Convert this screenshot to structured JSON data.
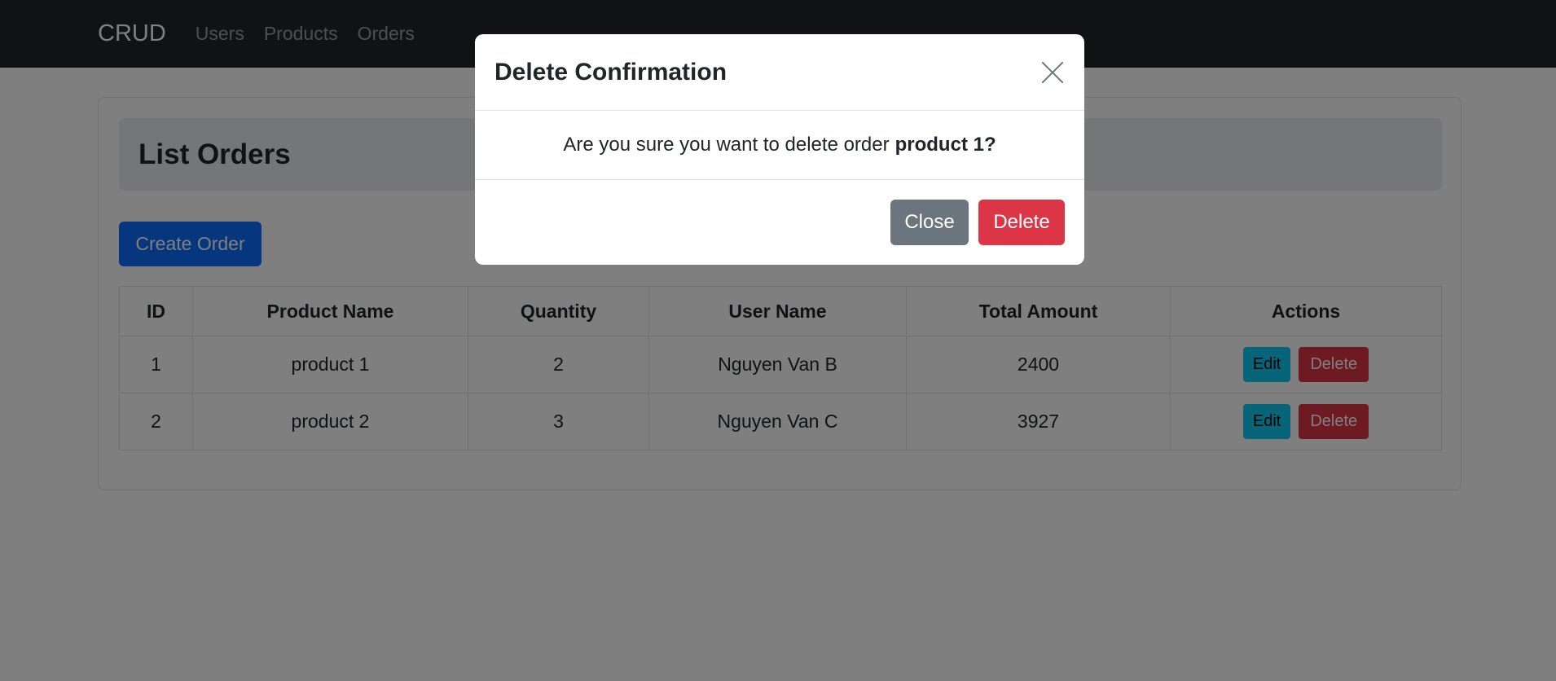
{
  "navbar": {
    "brand": "CRUD",
    "links": [
      "Users",
      "Products",
      "Orders"
    ]
  },
  "page": {
    "title": "List Orders",
    "create_button": "Create Order"
  },
  "table": {
    "headers": [
      "ID",
      "Product Name",
      "Quantity",
      "User Name",
      "Total Amount",
      "Actions"
    ],
    "rows": [
      {
        "id": "1",
        "product": "product 1",
        "quantity": "2",
        "user": "Nguyen Van B",
        "total": "2400"
      },
      {
        "id": "2",
        "product": "product 2",
        "quantity": "3",
        "user": "Nguyen Van C",
        "total": "3927"
      }
    ],
    "edit_label": "Edit",
    "delete_label": "Delete"
  },
  "modal": {
    "title": "Delete Confirmation",
    "message": "Are you sure you want to delete order",
    "target": "product 1?",
    "close_label": "Close",
    "delete_label": "Delete"
  },
  "colors": {
    "navbar": "#212529",
    "primary": "#0d6efd",
    "info": "#0dcaf0",
    "danger": "#dc3545",
    "secondary": "#6c757d"
  }
}
